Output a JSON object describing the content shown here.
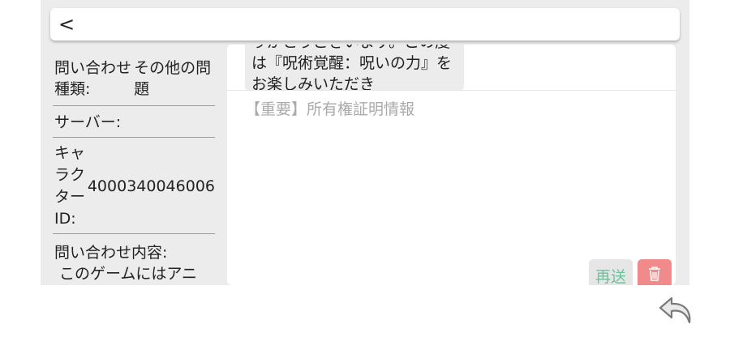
{
  "header": {
    "back_glyph": "<"
  },
  "info": {
    "type_label": "問い合わせ種類:",
    "type_value": "その他の問題",
    "server_label": "サーバー:",
    "server_value": "",
    "character_label": "キャラクターID:",
    "character_id": "4000340046006",
    "content_label": "問い合わせ内容:",
    "content_text": "このゲームにはアニ"
  },
  "chat": {
    "message_text": "りがとうございます。この度は『呪術覚醒：呪いの力』をお楽しみいただき",
    "input_placeholder": "【重要】所有権証明情報",
    "resend_label": "再送",
    "delete_icon": "trash-icon"
  },
  "footer": {
    "icon": "return-arrow-icon"
  },
  "colors": {
    "frame_bg": "#ececec",
    "resend_text": "#6cc29a",
    "delete_bg": "#f18b8b",
    "placeholder_text": "#aaaaaa"
  }
}
